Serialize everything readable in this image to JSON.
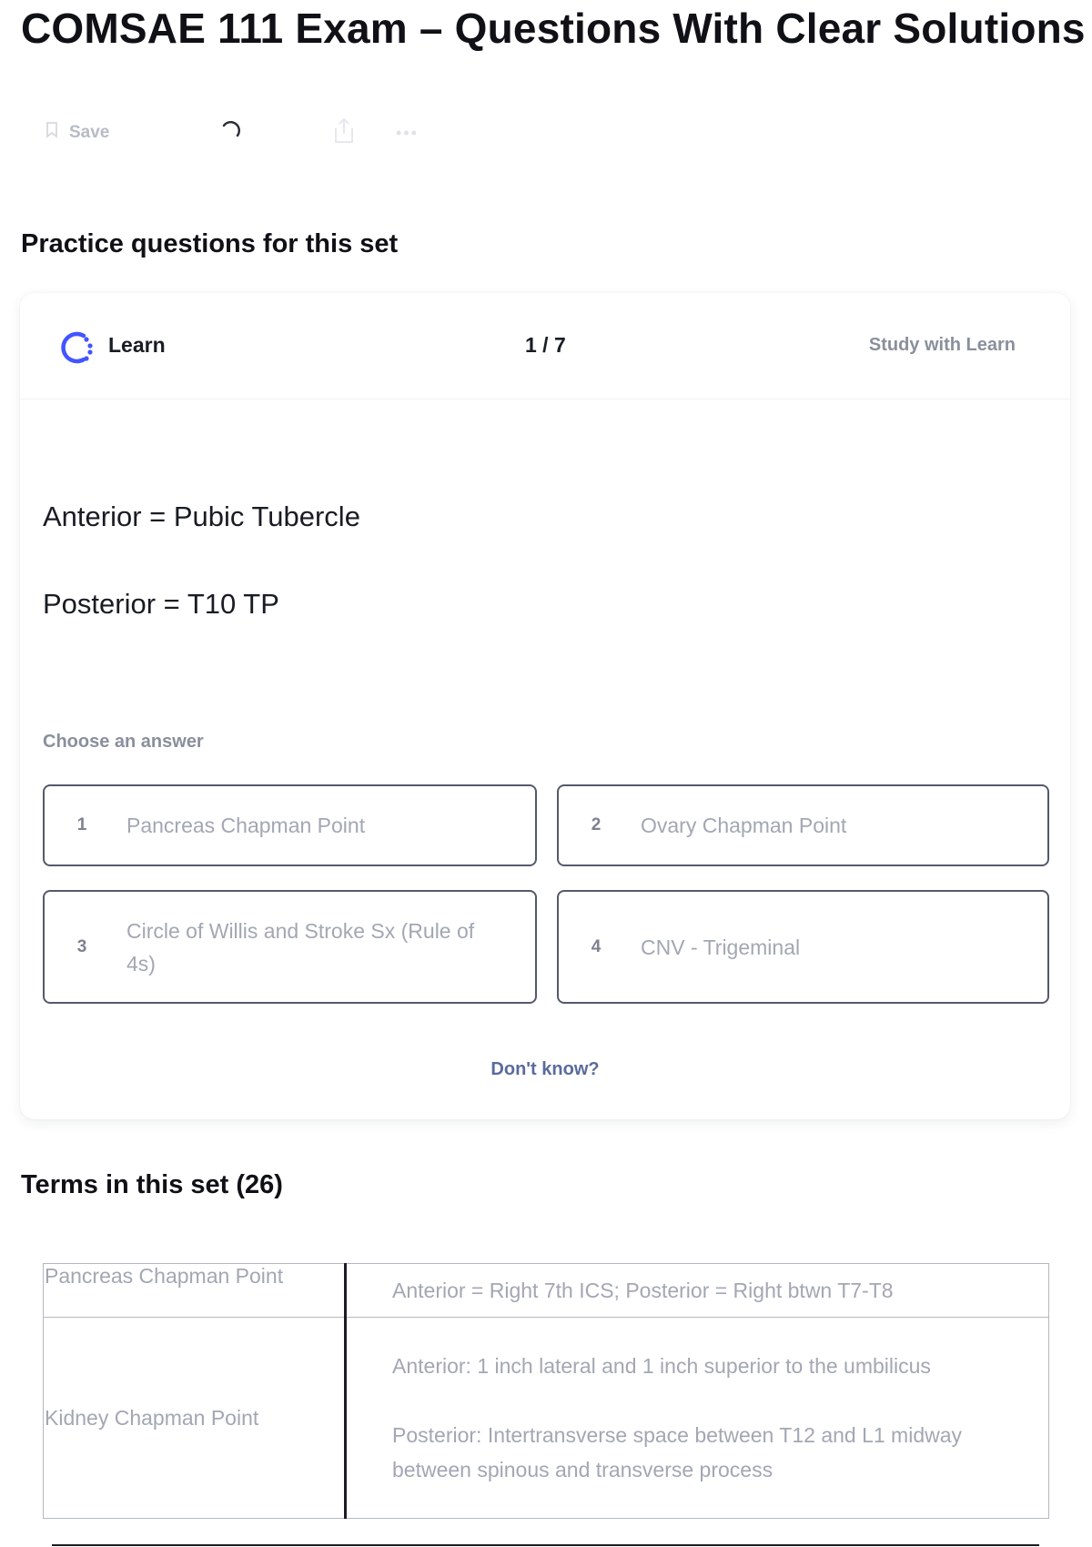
{
  "page": {
    "title": "COMSAE 111 Exam – Questions With Clear Solutions"
  },
  "toolbar": {
    "save_label": "Save",
    "icons": [
      "bookmark-icon",
      "loading-spinner-icon",
      "share-icon",
      "more-icon"
    ]
  },
  "practice": {
    "heading": "Practice questions for this set",
    "card": {
      "mode_label": "Learn",
      "mode_icon": "learn-progress-icon",
      "progress_text": "1 / 7",
      "study_link": "Study with Learn",
      "prompt_lines": [
        "Anterior = Pubic Tubercle",
        "Posterior = T10 TP"
      ],
      "choose_label": "Choose an answer",
      "options": [
        {
          "number": "1",
          "text": "Pancreas Chapman Point"
        },
        {
          "number": "2",
          "text": "Ovary Chapman Point"
        },
        {
          "number": "3",
          "text": "Circle of Willis and Stroke Sx (Rule of 4s)"
        },
        {
          "number": "4",
          "text": "CNV - Trigeminal"
        }
      ],
      "dont_know": "Don't know?"
    }
  },
  "terms": {
    "heading": "Terms in this set (26)",
    "rows": [
      {
        "term": "Pancreas Chapman Point",
        "definition": [
          "Anterior = Right 7th ICS; Posterior = Right btwn T7-T8"
        ]
      },
      {
        "term": "Kidney Chapman Point",
        "definition": [
          "Anterior: 1 inch lateral and 1 inch superior to the umbilicus",
          "Posterior: Intertransverse space between T12 and L1 midway between spinous and transverse process"
        ]
      }
    ]
  },
  "colors": {
    "learn_icon": "#4255ff",
    "option_border": "#55596c",
    "dont_know": "#5a6b9c"
  }
}
